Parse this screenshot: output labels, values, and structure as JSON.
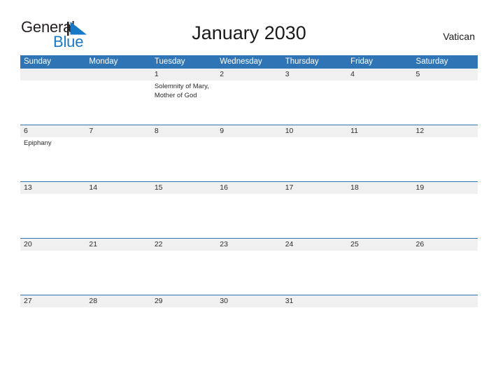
{
  "brand": {
    "name_part1": "General",
    "name_part2": "Blue",
    "mark_icon": "triangle-flag-icon",
    "accent_color": "#1878c8"
  },
  "header": {
    "title": "January 2030",
    "region": "Vatican"
  },
  "theme": {
    "header_blue": "#2f74b5",
    "band_gray": "#f0f0f0",
    "text_dark": "#2b2b2b"
  },
  "calendar": {
    "weekday_headers": [
      "Sunday",
      "Monday",
      "Tuesday",
      "Wednesday",
      "Thursday",
      "Friday",
      "Saturday"
    ],
    "weeks": [
      [
        {
          "day": "",
          "events": []
        },
        {
          "day": "",
          "events": []
        },
        {
          "day": "1",
          "events": [
            "Solemnity of Mary,",
            "Mother of God"
          ]
        },
        {
          "day": "2",
          "events": []
        },
        {
          "day": "3",
          "events": []
        },
        {
          "day": "4",
          "events": []
        },
        {
          "day": "5",
          "events": []
        }
      ],
      [
        {
          "day": "6",
          "events": [
            "Epiphany"
          ]
        },
        {
          "day": "7",
          "events": []
        },
        {
          "day": "8",
          "events": []
        },
        {
          "day": "9",
          "events": []
        },
        {
          "day": "10",
          "events": []
        },
        {
          "day": "11",
          "events": []
        },
        {
          "day": "12",
          "events": []
        }
      ],
      [
        {
          "day": "13",
          "events": []
        },
        {
          "day": "14",
          "events": []
        },
        {
          "day": "15",
          "events": []
        },
        {
          "day": "16",
          "events": []
        },
        {
          "day": "17",
          "events": []
        },
        {
          "day": "18",
          "events": []
        },
        {
          "day": "19",
          "events": []
        }
      ],
      [
        {
          "day": "20",
          "events": []
        },
        {
          "day": "21",
          "events": []
        },
        {
          "day": "22",
          "events": []
        },
        {
          "day": "23",
          "events": []
        },
        {
          "day": "24",
          "events": []
        },
        {
          "day": "25",
          "events": []
        },
        {
          "day": "26",
          "events": []
        }
      ],
      [
        {
          "day": "27",
          "events": []
        },
        {
          "day": "28",
          "events": []
        },
        {
          "day": "29",
          "events": []
        },
        {
          "day": "30",
          "events": []
        },
        {
          "day": "31",
          "events": []
        },
        {
          "day": "",
          "events": []
        },
        {
          "day": "",
          "events": []
        }
      ]
    ]
  }
}
